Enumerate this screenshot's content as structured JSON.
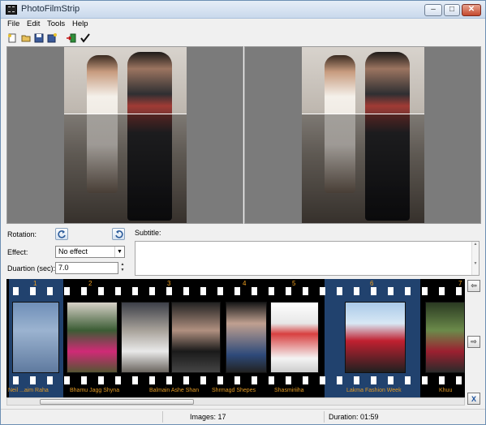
{
  "window": {
    "title": "PhotoFilmStrip"
  },
  "menu": [
    "File",
    "Edit",
    "Tools",
    "Help"
  ],
  "toolbar": {
    "icons": [
      "new-project-icon",
      "open-project-icon",
      "save-project-icon",
      "save-as-icon",
      "import-pictures-icon",
      "render-icon"
    ]
  },
  "controls": {
    "rotation_label": "Rotation:",
    "effect_label": "Effect:",
    "effect_value": "No effect",
    "duration_label": "Duartion (sec):",
    "duration_value": "7.0",
    "subtitle_label": "Subtitle:"
  },
  "filmstrip": {
    "frames": [
      {
        "number": "1",
        "caption": "Neil ...aim Raha"
      },
      {
        "number": "2",
        "caption": "Bhamu Jagg Shyna"
      },
      {
        "number": "3",
        "caption": "Balmain Ashe Shan"
      },
      {
        "number": "4",
        "caption": "Shrmagd Shepes"
      },
      {
        "number": "5",
        "caption": "Shasmiriiha"
      },
      {
        "number": "6",
        "caption": "Lakma Fashion Week"
      },
      {
        "number": "7",
        "caption": "Khuu"
      }
    ]
  },
  "status": {
    "images": "Images: 17",
    "duration": "Duration: 01:59"
  },
  "colors": {
    "film_bg": "#000000",
    "frame_number": "#f0a020",
    "selection": "#3c78c8",
    "preview_bg": "#7b7b7b"
  }
}
